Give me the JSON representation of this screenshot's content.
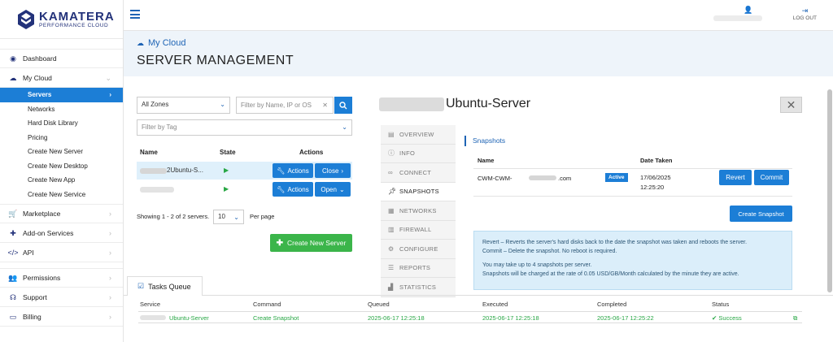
{
  "brand": {
    "name": "KAMATERA",
    "tagline": "PERFORMANCE CLOUD"
  },
  "topbar": {
    "logout_label": "LOG OUT"
  },
  "sidebar": {
    "items": [
      {
        "label": "Dashboard"
      },
      {
        "label": "My Cloud"
      },
      {
        "label": "Marketplace"
      },
      {
        "label": "Add-on Services"
      },
      {
        "label": "API"
      },
      {
        "label": "Permissions"
      },
      {
        "label": "Support"
      },
      {
        "label": "Billing"
      }
    ],
    "subitems": [
      {
        "label": "Servers"
      },
      {
        "label": "Networks"
      },
      {
        "label": "Hard Disk Library"
      },
      {
        "label": "Pricing"
      },
      {
        "label": "Create New Server"
      },
      {
        "label": "Create New Desktop"
      },
      {
        "label": "Create New App"
      },
      {
        "label": "Create New Service"
      }
    ]
  },
  "header": {
    "breadcrumb": "My Cloud",
    "title": "SERVER MANAGEMENT"
  },
  "filters": {
    "zone": "All Zones",
    "search_placeholder": "Filter by Name, IP or OS",
    "tag_placeholder": "Filter by Tag"
  },
  "servers": {
    "headers": {
      "name": "Name",
      "state": "State",
      "actions": "Actions"
    },
    "rows": [
      {
        "name": "2Ubuntu-S...",
        "actions_label": "Actions",
        "toggle_label": "Close"
      },
      {
        "name": "",
        "actions_label": "Actions",
        "toggle_label": "Open"
      }
    ],
    "showing": "Showing 1 - 2 of 2 servers.",
    "per_page_value": "10",
    "per_page_label": "Per page",
    "create_label": "Create New Server"
  },
  "detail": {
    "title": "Ubuntu-Server",
    "tabs": [
      {
        "label": "OVERVIEW"
      },
      {
        "label": "INFO"
      },
      {
        "label": "CONNECT"
      },
      {
        "label": "SNAPSHOTS"
      },
      {
        "label": "NETWORKS"
      },
      {
        "label": "FIREWALL"
      },
      {
        "label": "CONFIGURE"
      },
      {
        "label": "REPORTS"
      },
      {
        "label": "STATISTICS"
      }
    ],
    "active_tab": "SNAPSHOTS"
  },
  "snapshots": {
    "section_title": "Snapshots",
    "headers": {
      "name": "Name",
      "date": "Date Taken"
    },
    "row": {
      "name_prefix": "CWM-CWM-",
      "name_suffix": ".com",
      "status": "Active",
      "date": "17/06/2025",
      "time": "12:25:20",
      "revert_label": "Revert",
      "commit_label": "Commit"
    },
    "create_label": "Create Snapshot",
    "info": [
      "Revert – Reverts the server's hard disks back to the date the snapshot was taken and reboots the server.",
      "Commit – Delete the snapshot. No reboot is required.",
      "You may take up to 4 snapshots per server.",
      "Snapshots will be charged at the rate of 0.05 USD/GB/Month calculated by the minute they are active."
    ]
  },
  "tasks": {
    "tab_label": "Tasks Queue",
    "headers": {
      "service": "Service",
      "command": "Command",
      "queued": "Queued",
      "executed": "Executed",
      "completed": "Completed",
      "status": "Status"
    },
    "rows": [
      {
        "service": "Ubuntu-Server",
        "command": "Create Snapshot",
        "queued": "2025-06-17 12:25:18",
        "executed": "2025-06-17 12:25:18",
        "completed": "2025-06-17 12:25:22",
        "status": "Success"
      }
    ]
  },
  "colors": {
    "primary": "#1c7ed6",
    "brand": "#23327a",
    "success": "#28a745",
    "create_green": "#3bb54a"
  }
}
